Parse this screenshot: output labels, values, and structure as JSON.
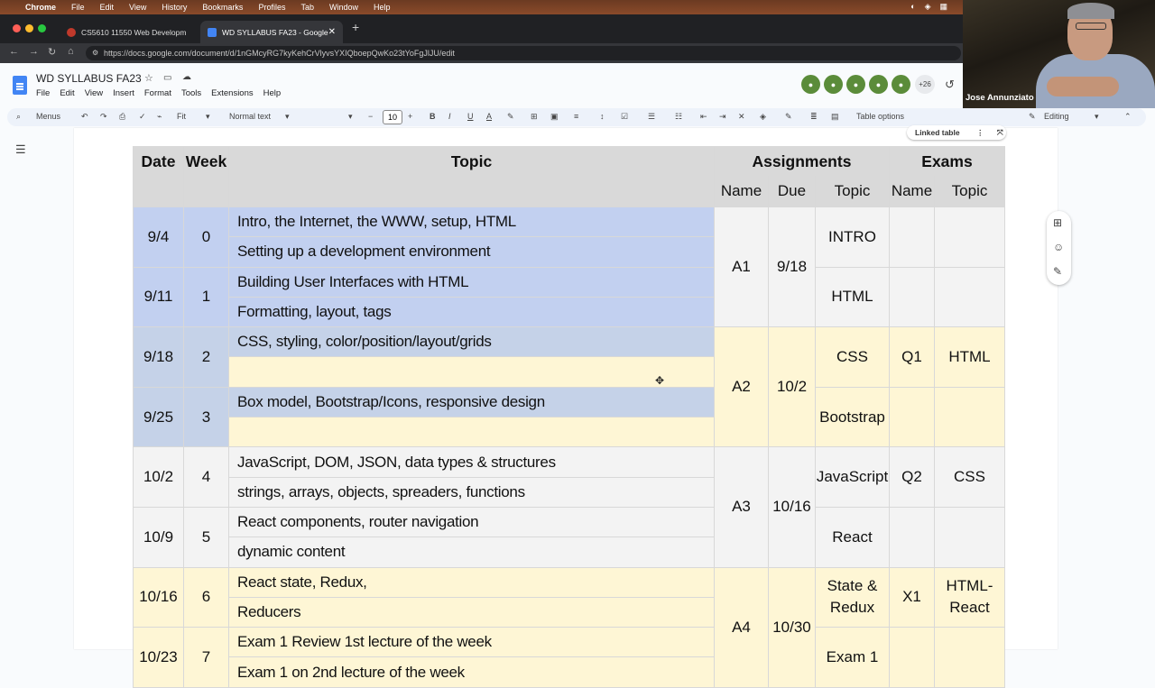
{
  "menubar": {
    "app": "Chrome",
    "items": [
      "File",
      "Edit",
      "View",
      "History",
      "Bookmarks",
      "Profiles",
      "Tab",
      "Window",
      "Help"
    ]
  },
  "browser": {
    "tabs": [
      {
        "title": "CS5610 11550 Web Developm",
        "favicon_color": "#c0392b"
      },
      {
        "title": "WD SYLLABUS FA23 - Google",
        "favicon_color": "#4285f4"
      }
    ],
    "url": "https://docs.google.com/document/d/1nGMcyRG7kyKehCrVlyvsYXIQboepQwKo23tYoFgJlJU/edit"
  },
  "docs": {
    "title": "WD SYLLABUS FA23",
    "menu": [
      "File",
      "Edit",
      "View",
      "Insert",
      "Format",
      "Tools",
      "Extensions",
      "Help"
    ],
    "collaborators_more": "+26",
    "toolbar": {
      "menus": "Menus",
      "zoom": "Fit",
      "style": "Normal text",
      "font_size": "10",
      "table_options": "Table options",
      "mode": "Editing"
    },
    "linked_table": "Linked table"
  },
  "table": {
    "headers": {
      "date": "Date",
      "week": "Week",
      "topic": "Topic",
      "assignments": "Assignments",
      "exams": "Exams",
      "name": "Name",
      "due": "Due",
      "topic_sub": "Topic"
    },
    "rows": [
      {
        "date": "9/4",
        "week": "0",
        "topics": [
          "Intro, the Internet, the WWW, setup, HTML",
          "Setting up a development environment"
        ]
      },
      {
        "date": "9/11",
        "week": "1",
        "topics": [
          "Building User Interfaces with HTML",
          "Formatting, layout, tags"
        ]
      },
      {
        "date": "9/18",
        "week": "2",
        "topics": [
          "CSS, styling, color/position/layout/grids",
          ""
        ]
      },
      {
        "date": "9/25",
        "week": "3",
        "topics": [
          "Box model, Bootstrap/Icons, responsive design",
          ""
        ]
      },
      {
        "date": "10/2",
        "week": "4",
        "topics": [
          "JavaScript, DOM, JSON, data types & structures",
          "strings, arrays, objects, spreaders, functions"
        ]
      },
      {
        "date": "10/9",
        "week": "5",
        "topics": [
          "React components, router navigation",
          "dynamic content"
        ]
      },
      {
        "date": "10/16",
        "week": "6",
        "topics": [
          "React state, Redux,",
          "Reducers"
        ]
      },
      {
        "date": "10/23",
        "week": "7",
        "topics": [
          "Exam 1 Review 1st lecture of the week",
          "Exam 1 on 2nd lecture of the week"
        ]
      }
    ],
    "assignments": [
      {
        "name": "A1",
        "due": "9/18",
        "topics": [
          "INTRO",
          "HTML"
        ]
      },
      {
        "name": "A2",
        "due": "10/2",
        "topics": [
          "CSS",
          "Bootstrap"
        ]
      },
      {
        "name": "A3",
        "due": "10/16",
        "topics": [
          "JavaScript",
          "React"
        ]
      },
      {
        "name": "A4",
        "due": "10/30",
        "topics": [
          "State & Redux",
          "Exam 1"
        ]
      }
    ],
    "exams": [
      {
        "name": "",
        "topic": ""
      },
      {
        "name": "",
        "topic": ""
      },
      {
        "name": "Q1",
        "topic": "HTML"
      },
      {
        "name": "",
        "topic": ""
      },
      {
        "name": "Q2",
        "topic": "CSS"
      },
      {
        "name": "",
        "topic": ""
      },
      {
        "name": "X1",
        "topic": "HTML-React"
      },
      {
        "name": "",
        "topic": ""
      }
    ]
  },
  "webcam": {
    "name": "Jose Annunziato"
  },
  "colors": {
    "header_gray": "#d9d9d9",
    "row_gray": "#f3f3f3",
    "row_yellow": "#fef6d5",
    "selection": "#c2d0f0"
  }
}
